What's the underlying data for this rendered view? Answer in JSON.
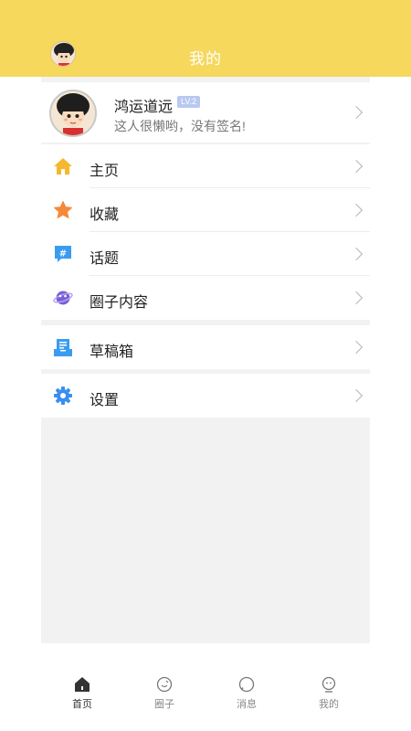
{
  "header": {
    "title": "我的"
  },
  "profile": {
    "name": "鸿运道远",
    "level": "LV.2",
    "signature": "这人很懒哟，没有签名!"
  },
  "menu": {
    "group1": [
      {
        "label": "主页",
        "icon": "home-icon"
      },
      {
        "label": "收藏",
        "icon": "star-icon"
      },
      {
        "label": "话题",
        "icon": "hashtag-icon"
      },
      {
        "label": "圈子内容",
        "icon": "planet-icon"
      }
    ],
    "group2": [
      {
        "label": "草稿箱",
        "icon": "draft-box-icon"
      }
    ],
    "group3": [
      {
        "label": "设置",
        "icon": "gear-icon"
      }
    ]
  },
  "tabbar": [
    {
      "label": "首页",
      "icon": "home-tab-icon",
      "active": true
    },
    {
      "label": "圈子",
      "icon": "circle-tab-icon",
      "active": false
    },
    {
      "label": "消息",
      "icon": "message-tab-icon",
      "active": false
    },
    {
      "label": "我的",
      "icon": "profile-tab-icon",
      "active": false
    }
  ],
  "colors": {
    "header_bg": "#f5d85c",
    "home_icon": "#f5b82e",
    "star_icon": "#f5893a",
    "hashtag_icon": "#3a9cf0",
    "planet_icon": "#7a5ed8",
    "draft_icon": "#3a9cf0",
    "gear_icon": "#3a8ef0",
    "level_badge": "#b8c8f0"
  }
}
